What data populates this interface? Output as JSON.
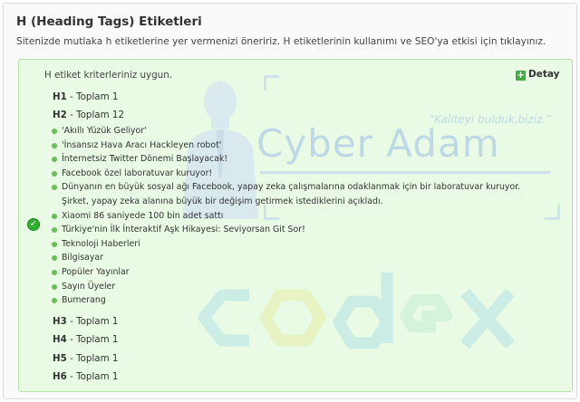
{
  "section": {
    "title": "H (Heading Tags) Etiketleri",
    "description": "Sitenizde mutlaka h etiketlerine yer vermenizi öneririz. H etiketlerinin kullanımı ve SEO'ya etkisi için tıklayınız."
  },
  "result": {
    "status_icon": "check-circle-icon",
    "message": "H etiket kriterleriniz uygun.",
    "detail_label": "Detay",
    "detail_icon": "plus-icon",
    "accent_color": "#2fae2f",
    "panel_bg": "#e9fbe4"
  },
  "headings": {
    "h1": {
      "tag": "H1",
      "count": "- Toplam 1"
    },
    "h2": {
      "tag": "H2",
      "count": "- Toplam 12"
    },
    "h3": {
      "tag": "H3",
      "count": "- Toplam 1"
    },
    "h4": {
      "tag": "H4",
      "count": "- Toplam 1"
    },
    "h5": {
      "tag": "H5",
      "count": "- Toplam 1"
    },
    "h6": {
      "tag": "H6",
      "count": "- Toplam 1"
    }
  },
  "h2_items": [
    "'Akıllı Yüzük Geliyor'",
    "'İnsansız Hava Aracı Hackleyen robot'",
    "İnternetsiz Twitter Dönemi Başlayacak!",
    "Facebook özel laboratuvar kuruyor!",
    "Dünyanın en büyük sosyal ağı Facebook, yapay zeka çalışmalarına odaklanmak için bir laboratuvar kuruyor. Şirket, yapay zeka alanına büyük bir değişim getirmek istediklerini açıkladı.",
    "Xiaomi 86 saniyede 100 bin adet sattı",
    "Türkiye'nin İlk İnteraktif Aşk Hikayesi: Seviyorsan Git Sor!",
    "Teknoloji Haberleri",
    "Bilgisayar",
    "Popüler Yayınlar",
    "Sayın Üyeler",
    "Bumerang"
  ],
  "watermark": {
    "slogan": "“Kaliteyi bulduk,biziz.”",
    "brand": "Cyber Adam",
    "logo": "codex"
  }
}
